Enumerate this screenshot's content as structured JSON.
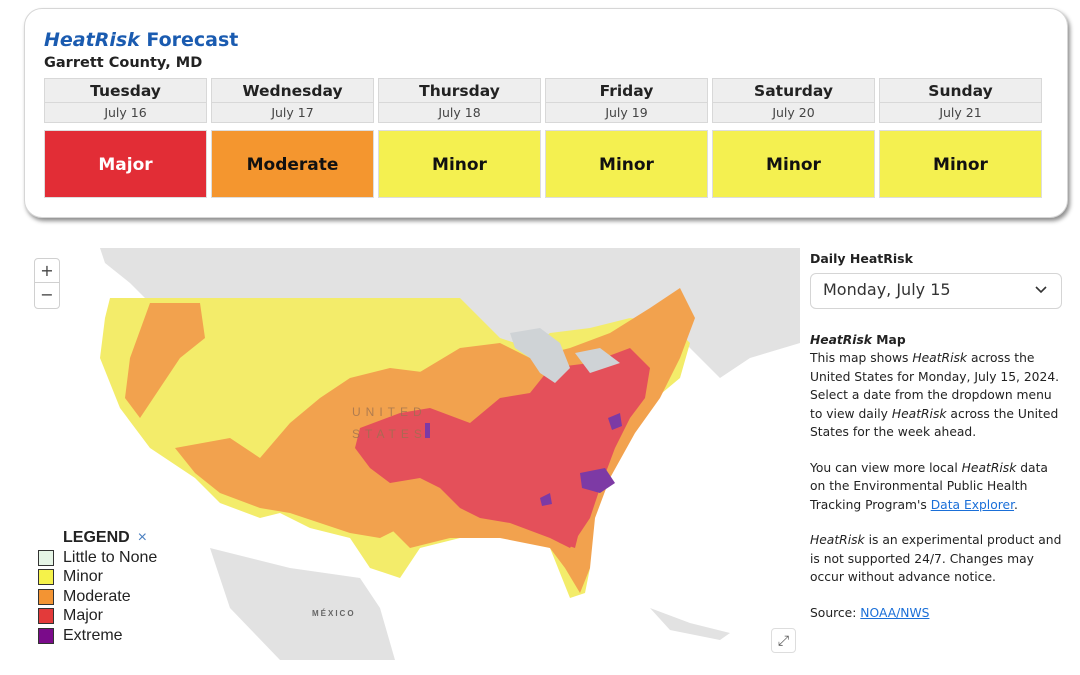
{
  "forecast": {
    "title_italic": "HeatRisk",
    "title_rest": " Forecast",
    "location": "Garrett County, MD",
    "days": [
      {
        "day": "Tuesday",
        "date": "July 16",
        "risk": "Major",
        "color": "#e22d36",
        "text_color": "#ffffff"
      },
      {
        "day": "Wednesday",
        "date": "July 17",
        "risk": "Moderate",
        "color": "#f4962f",
        "text_color": "#111111"
      },
      {
        "day": "Thursday",
        "date": "July 18",
        "risk": "Minor",
        "color": "#f4f050",
        "text_color": "#111111"
      },
      {
        "day": "Friday",
        "date": "July 19",
        "risk": "Minor",
        "color": "#f4f050",
        "text_color": "#111111"
      },
      {
        "day": "Saturday",
        "date": "July 20",
        "risk": "Minor",
        "color": "#f4f050",
        "text_color": "#111111"
      },
      {
        "day": "Sunday",
        "date": "July 21",
        "risk": "Minor",
        "color": "#f4f050",
        "text_color": "#111111"
      }
    ]
  },
  "map": {
    "zoom_in": "+",
    "zoom_out": "−",
    "country_label_line1": "UNITED",
    "country_label_line2": "STATES",
    "mexico_label": "MÉXICO",
    "expand_icon": "⤢",
    "colors": {
      "land": "#e2e2e2",
      "water": "#ffffff",
      "lakes": "#cfd3d6",
      "minor": "#f3ec6a",
      "moderate": "#f2a24e",
      "major": "#e4505a",
      "extreme": "#7d3aa5"
    },
    "legend": {
      "title": "LEGEND",
      "close": "×",
      "items": [
        {
          "label": "Little to None",
          "color": "#e6f5e6"
        },
        {
          "label": "Minor",
          "color": "#f5f24a"
        },
        {
          "label": "Moderate",
          "color": "#f39433"
        },
        {
          "label": "Major",
          "color": "#e33a3a"
        },
        {
          "label": "Extreme",
          "color": "#7a0b8a"
        }
      ]
    }
  },
  "sidebar": {
    "select_label": "Daily HeatRisk",
    "selected_date": "Monday, July 15",
    "heading_italic": "HeatRisk",
    "heading_rest": " Map",
    "p1_a": "This map shows ",
    "p1_i": "HeatRisk",
    "p1_b": " across the United States for Monday, July 15, 2024. Select a date from the dropdown menu to view daily ",
    "p1_i2": "HeatRisk",
    "p1_c": " across the United States for the week ahead.",
    "p2_a": "You can view more local ",
    "p2_i": "HeatRisk",
    "p2_b": " data on the Environmental Public Health Tracking Program's ",
    "p2_link": "Data Explorer",
    "p2_c": ".",
    "p3_i": "HeatRisk",
    "p3_b": " is an experimental product and is not supported 24/7. Changes may occur without advance notice.",
    "source_label": "Source: ",
    "source_link": "NOAA/NWS"
  }
}
